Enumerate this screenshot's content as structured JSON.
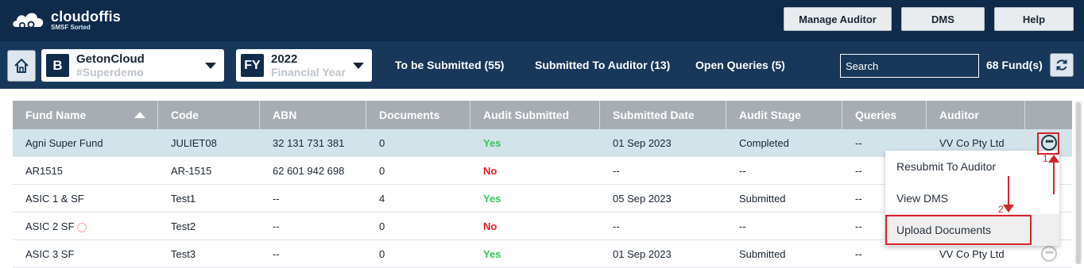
{
  "header": {
    "brand": "cloudoffis",
    "tagline": "SMSF Sorted",
    "buttons": [
      "Manage Auditor",
      "DMS",
      "Help"
    ]
  },
  "subbar": {
    "client": {
      "badge": "B",
      "name": "GetonCloud",
      "sub": "#Superdemo"
    },
    "fy": {
      "badge": "FY",
      "year": "2022",
      "label": "Financial Year"
    },
    "links": [
      "To be Submitted (55)",
      "Submitted To Auditor (13)",
      "Open Queries (5)"
    ],
    "search_placeholder": "Search",
    "fund_count": "68 Fund(s)"
  },
  "table": {
    "columns": [
      "Fund Name",
      "Code",
      "ABN",
      "Documents",
      "Audit Submitted",
      "Submitted Date",
      "Audit Stage",
      "Queries",
      "Auditor"
    ],
    "rows": [
      {
        "fund": "Agni Super Fund",
        "code": "JULIET08",
        "abn": "32 131 731 381",
        "docs": "0",
        "submitted": "Yes",
        "date": "01 Sep 2023",
        "stage": "Completed",
        "queries": "--",
        "auditor": "VV Co Pty Ltd"
      },
      {
        "fund": "AR1515",
        "code": "AR-1515",
        "abn": "62 601 942 698",
        "docs": "0",
        "submitted": "No",
        "date": "--",
        "stage": "--",
        "queries": "--",
        "auditor": ""
      },
      {
        "fund": "ASIC 1 & SF",
        "code": "Test1",
        "abn": "--",
        "docs": "4",
        "submitted": "Yes",
        "date": "05 Sep 2023",
        "stage": "Submitted",
        "queries": "--",
        "auditor": ""
      },
      {
        "fund": "ASIC 2 SF",
        "code": "Test2",
        "abn": "--",
        "docs": "0",
        "submitted": "No",
        "date": "--",
        "stage": "--",
        "queries": "--",
        "auditor": ""
      },
      {
        "fund": "ASIC 3 SF",
        "code": "Test3",
        "abn": "--",
        "docs": "0",
        "submitted": "Yes",
        "date": "01 Sep 2023",
        "stage": "Submitted",
        "queries": "--",
        "auditor": "VV Co Pty Ltd"
      }
    ]
  },
  "menu": {
    "items": [
      "Resubmit To Auditor",
      "View DMS",
      "Upload Documents"
    ]
  },
  "annotations": [
    "1",
    "2"
  ],
  "colors": {
    "topbar": "#0e2b4b",
    "subbar": "#17385a",
    "header": "#a7adb3",
    "yes": "#34c759",
    "no": "#e02020",
    "annotation": "#d6222a"
  }
}
